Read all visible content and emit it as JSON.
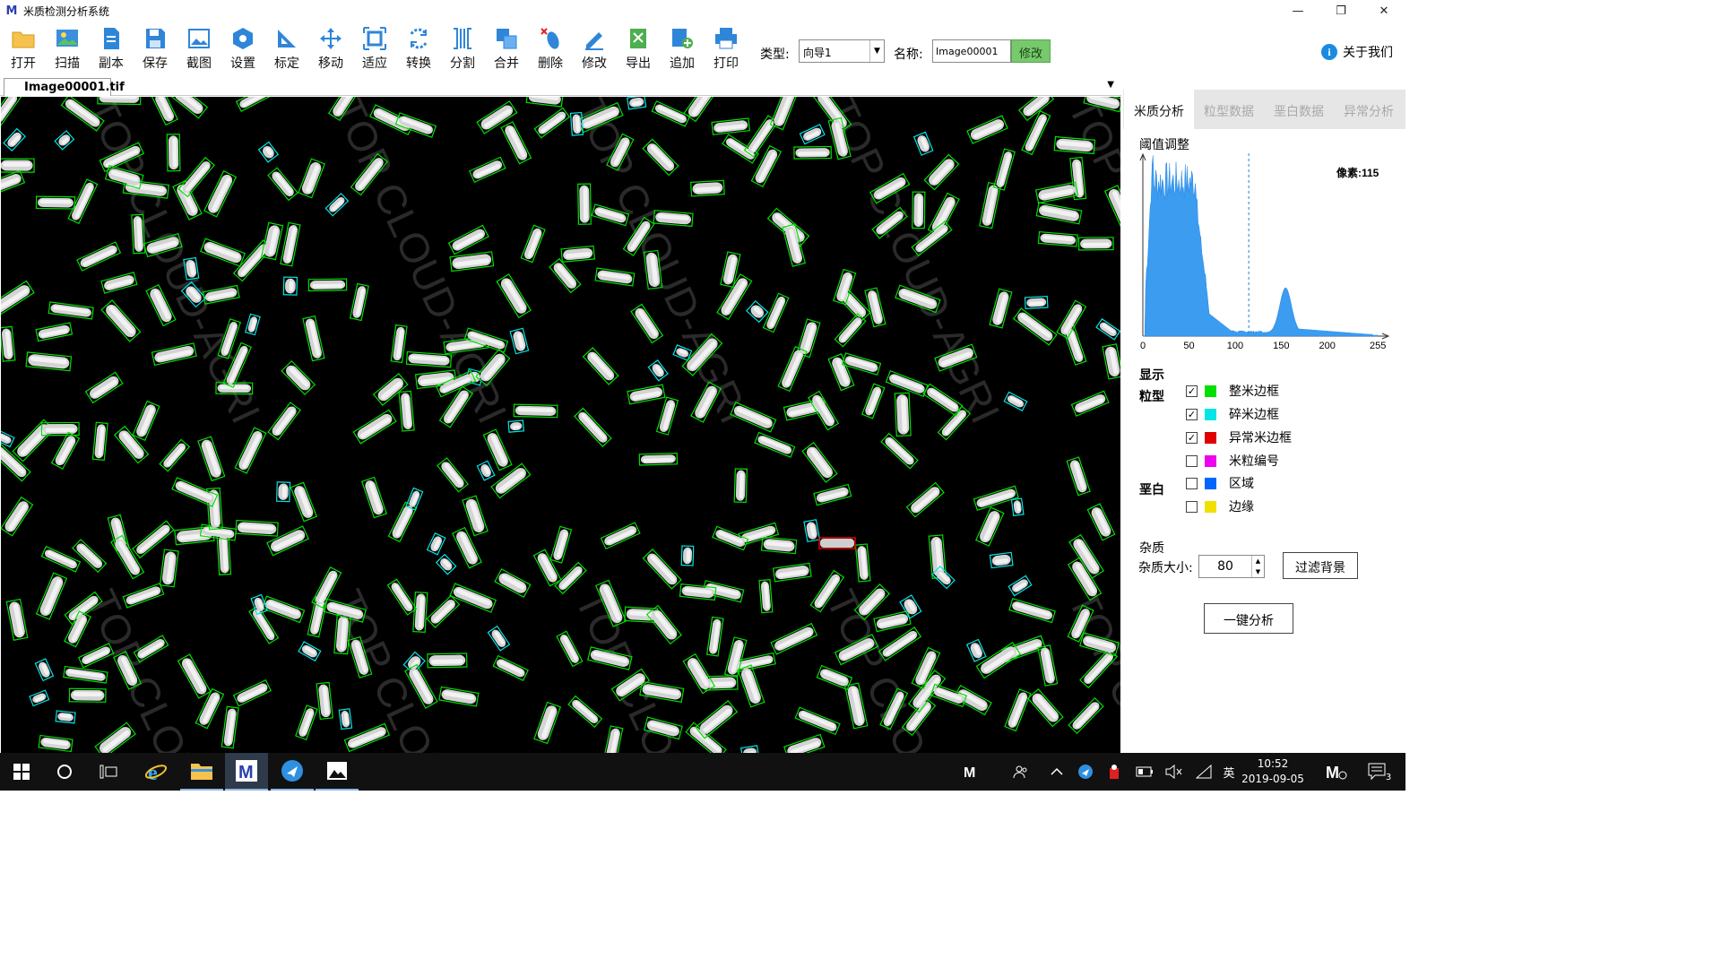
{
  "window": {
    "title": "米质检测分析系统",
    "logo": "M",
    "controls": [
      "—",
      "❐",
      "✕"
    ]
  },
  "toolbar": {
    "tools": [
      {
        "label": "打开",
        "icon": "folder-icon"
      },
      {
        "label": "扫描",
        "icon": "scan-icon"
      },
      {
        "label": "副本",
        "icon": "copy-icon"
      },
      {
        "label": "保存",
        "icon": "save-icon"
      },
      {
        "label": "截图",
        "icon": "screenshot-icon"
      },
      {
        "label": "设置",
        "icon": "settings-icon"
      },
      {
        "label": "标定",
        "icon": "calibrate-icon"
      },
      {
        "label": "移动",
        "icon": "move-icon"
      },
      {
        "label": "适应",
        "icon": "fit-icon"
      },
      {
        "label": "转换",
        "icon": "convert-icon"
      },
      {
        "label": "分割",
        "icon": "split-icon"
      },
      {
        "label": "合并",
        "icon": "merge-icon"
      },
      {
        "label": "删除",
        "icon": "delete-icon"
      },
      {
        "label": "修改",
        "icon": "edit-icon"
      },
      {
        "label": "导出",
        "icon": "export-icon"
      },
      {
        "label": "追加",
        "icon": "append-icon"
      },
      {
        "label": "打印",
        "icon": "print-icon"
      }
    ],
    "type_label": "类型:",
    "type_value": "向导1",
    "name_label": "名称:",
    "name_value": "Image00001",
    "modify_label": "修改",
    "about_label": "关于我们"
  },
  "image_tab": {
    "label": "Image00001.tif"
  },
  "panel": {
    "tabs": [
      "米质分析",
      "粒型数据",
      "垩白数据",
      "异常分析"
    ],
    "active_tab": 0,
    "histogram": {
      "title": "阈值调整",
      "pixel_label": "像素:115",
      "threshold": 115,
      "x_ticks": [
        "0",
        "50",
        "100",
        "150",
        "200",
        "255"
      ]
    },
    "display_label": "显示",
    "grain_label": "粒型",
    "chalk_label": "垩白",
    "checkboxes": [
      {
        "label": "整米边框",
        "checked": true,
        "color": "#00e000"
      },
      {
        "label": "碎米边框",
        "checked": true,
        "color": "#00e5e5"
      },
      {
        "label": "异常米边框",
        "checked": true,
        "color": "#e00000"
      },
      {
        "label": "米粒编号",
        "checked": false,
        "color": "#ee00ee"
      },
      {
        "label": "区域",
        "checked": false,
        "color": "#0066ff"
      },
      {
        "label": "边缘",
        "checked": false,
        "color": "#f0e000"
      }
    ],
    "impurity_title": "杂质",
    "impurity_size_label": "杂质大小:",
    "impurity_size": "80",
    "filter_button": "过滤背景",
    "analyze_button": "一键分析"
  },
  "watermark": "TOP CLOUD-AGRI",
  "taskbar": {
    "ime": "英",
    "time": "10:52",
    "date": "2019-09-05",
    "notifications": "3"
  }
}
